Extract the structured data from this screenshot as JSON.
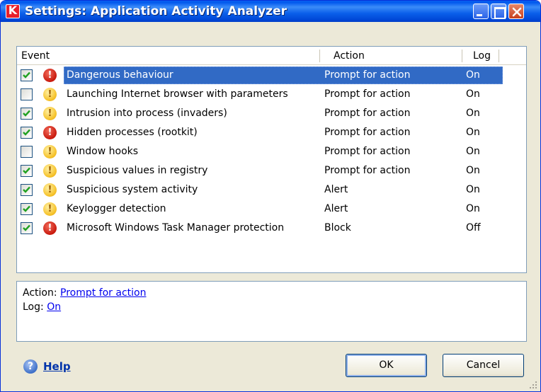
{
  "window": {
    "title": "Settings: Application Activity Analyzer",
    "app_logo_letter": "K"
  },
  "list": {
    "headers": {
      "event": "Event",
      "action": "Action",
      "log": "Log"
    },
    "rows": [
      {
        "checked": true,
        "severity": "danger",
        "event": "Dangerous behaviour",
        "action": "Prompt for action",
        "log": "On",
        "selected": true
      },
      {
        "checked": false,
        "severity": "warning",
        "event": "Launching Internet browser with parameters",
        "action": "Prompt for action",
        "log": "On"
      },
      {
        "checked": true,
        "severity": "warning",
        "event": "Intrusion into process (invaders)",
        "action": "Prompt for action",
        "log": "On"
      },
      {
        "checked": true,
        "severity": "danger",
        "event": "Hidden processes (rootkit)",
        "action": "Prompt for action",
        "log": "On"
      },
      {
        "checked": false,
        "severity": "warning",
        "event": "Window hooks",
        "action": "Prompt for action",
        "log": "On"
      },
      {
        "checked": true,
        "severity": "warning",
        "event": "Suspicious values in registry",
        "action": "Prompt for action",
        "log": "On"
      },
      {
        "checked": true,
        "severity": "warning",
        "event": "Suspicious system activity",
        "action": "Alert",
        "log": "On"
      },
      {
        "checked": true,
        "severity": "warning",
        "event": "Keylogger detection",
        "action": "Alert",
        "log": "On"
      },
      {
        "checked": true,
        "severity": "danger",
        "event": "Microsoft Windows Task Manager protection",
        "action": "Block",
        "log": "Off"
      }
    ]
  },
  "details": {
    "action_label": "Action:",
    "action_value": "Prompt for action",
    "log_label": "Log:",
    "log_value": "On"
  },
  "footer": {
    "help_label": "Help",
    "help_icon_glyph": "?",
    "ok_label": "OK",
    "cancel_label": "Cancel"
  },
  "colors": {
    "selection": "#316ac5",
    "titlebar": "#0058ee",
    "danger": "#c8190d",
    "warning": "#f6c22a"
  },
  "icons": {
    "danger": "exclamation-danger-icon",
    "warning": "exclamation-warning-icon",
    "help": "help-icon"
  }
}
